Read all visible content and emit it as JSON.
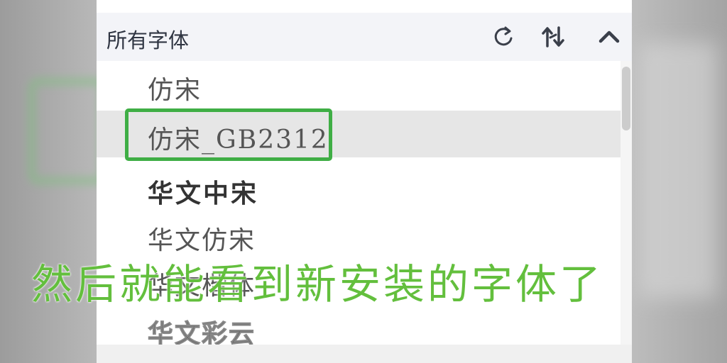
{
  "header": {
    "title": "所有字体",
    "icons": [
      "refresh-icon",
      "sort-icon",
      "collapse-icon"
    ]
  },
  "fonts": [
    {
      "label": "仿宋",
      "selected": false
    },
    {
      "label": "仿宋_GB2312",
      "selected": true
    },
    {
      "label": "华文中宋",
      "selected": false
    },
    {
      "label": "华文仿宋",
      "selected": false
    },
    {
      "label": "华文楷体",
      "selected": false
    },
    {
      "label": "华文彩云",
      "selected": false
    }
  ],
  "subtitle": "然后就能看到新安装的字体了",
  "colors": {
    "highlight": "#3fae45",
    "subtitle": "#63bf3d",
    "header_bg": "#f3f4f8",
    "selected_bg": "#e6e6e6"
  }
}
